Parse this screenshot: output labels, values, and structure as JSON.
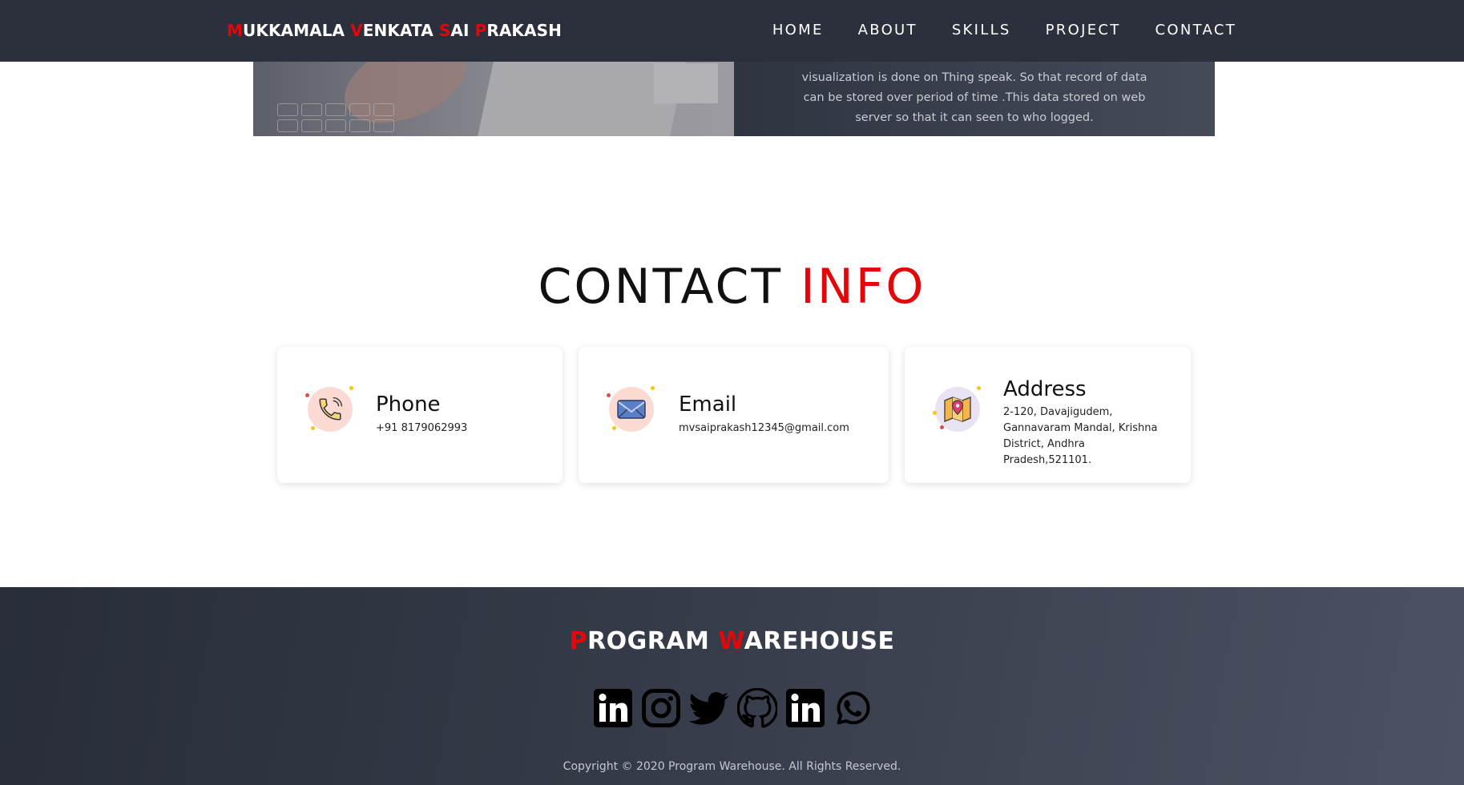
{
  "header": {
    "brand": [
      {
        "initial": "M",
        "rest": "UKKAMALA "
      },
      {
        "initial": "V",
        "rest": "ENKATA "
      },
      {
        "initial": "S",
        "rest": "AI "
      },
      {
        "initial": "P",
        "rest": "RAKASH"
      }
    ],
    "nav": [
      "HOME",
      "ABOUT",
      "SKILLS",
      "PROJECT",
      "CONTACT"
    ]
  },
  "project": {
    "description_lines": [
      "visualization is done on Thing speak. So that record of data",
      "can be stored over period of time .This data stored on web",
      "server so that it can seen to who logged."
    ]
  },
  "contact": {
    "title_main": "CONTACT ",
    "title_accent": "INFO",
    "cards": {
      "phone": {
        "label": "Phone",
        "value": "+91 8179062993",
        "icon": "phone-icon"
      },
      "email": {
        "label": "Email",
        "value": "mvsaiprakash12345@gmail.com",
        "icon": "envelope-icon"
      },
      "address": {
        "label": "Address",
        "value": "2-120, Davajigudem, Gannavaram Mandal, Krishna District, Andhra Pradesh,521101.",
        "icon": "map-pin-icon"
      }
    }
  },
  "footer": {
    "brand": [
      {
        "initial": "P",
        "rest": "ROGRAM "
      },
      {
        "initial": "W",
        "rest": "AREHOUSE"
      }
    ],
    "social": [
      "linkedin-icon",
      "instagram-icon",
      "twitter-icon",
      "github-icon",
      "linkedin-icon",
      "whatsapp-icon"
    ],
    "copyright": "Copyright © 2020 Program Warehouse. All Rights Reserved."
  },
  "colors": {
    "accent": "#e4070a",
    "navbar": "#2b303c",
    "footer": "#353b48"
  }
}
